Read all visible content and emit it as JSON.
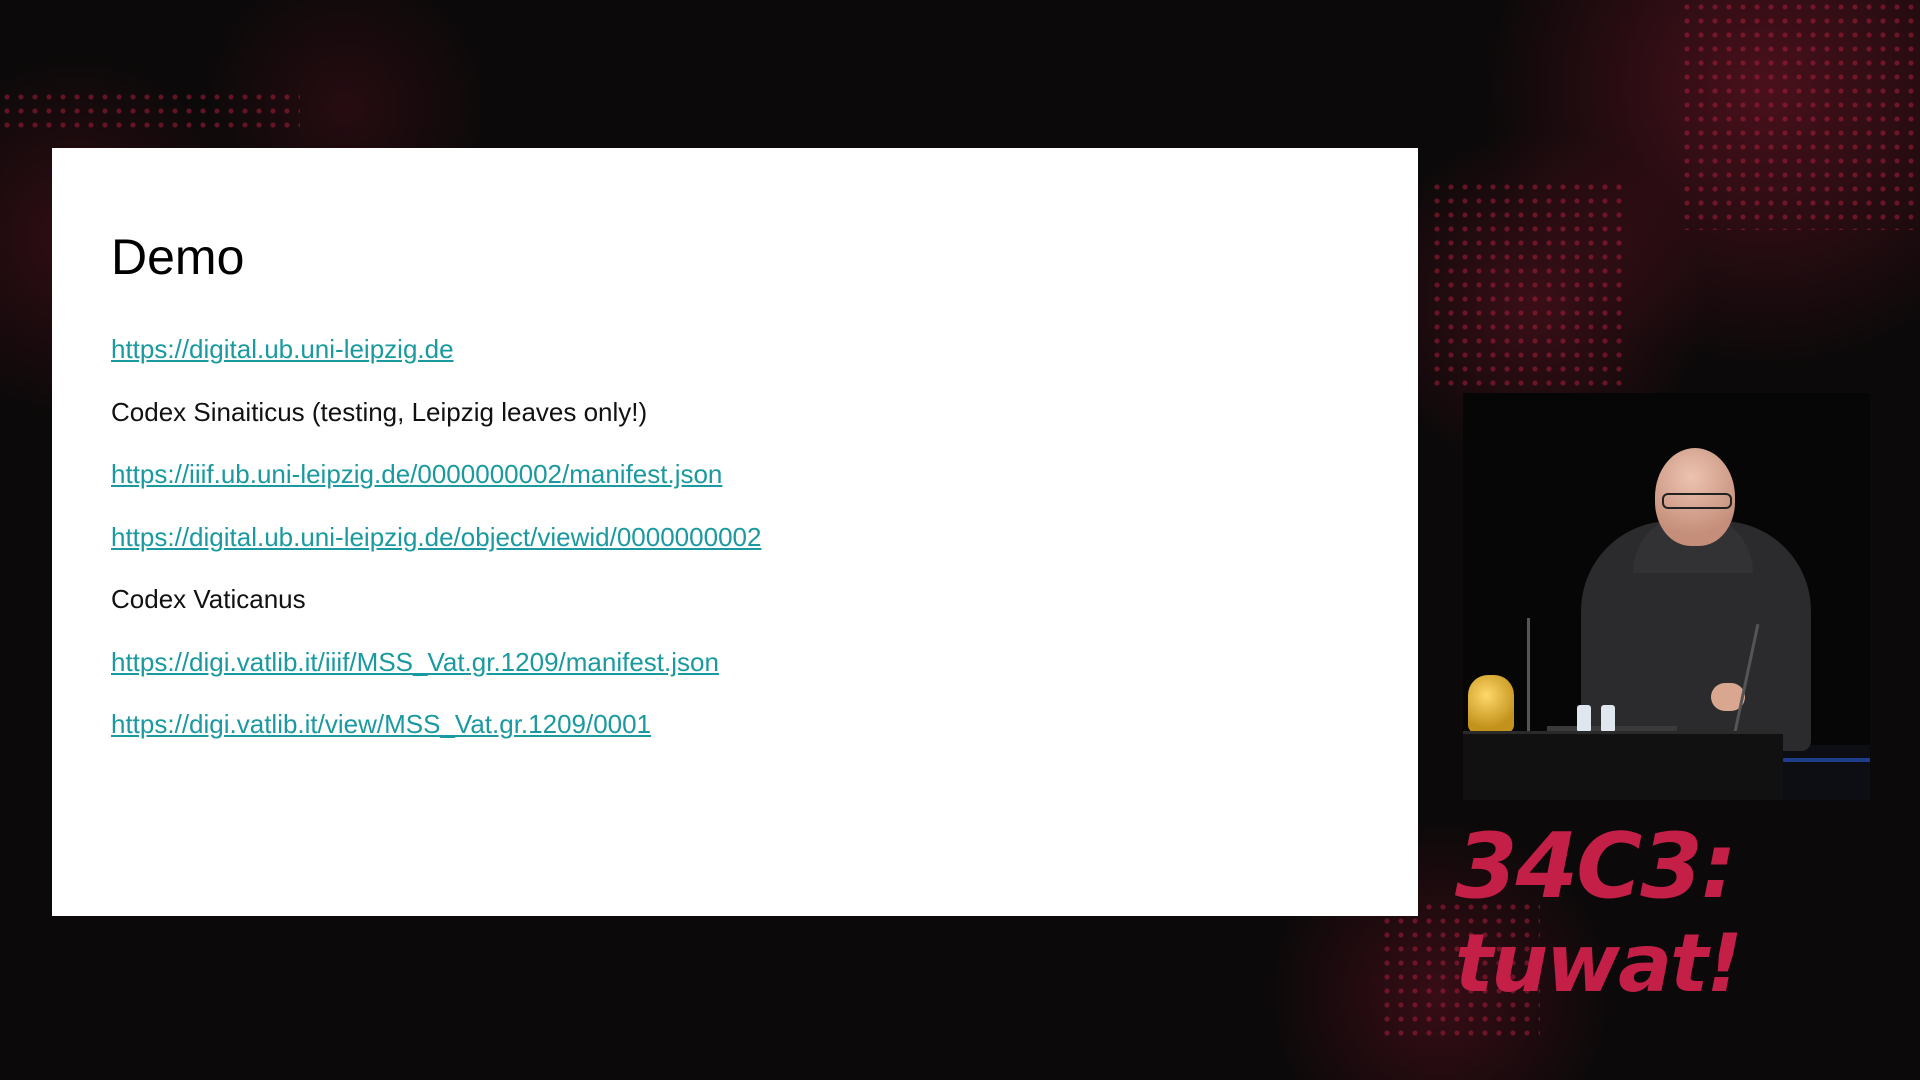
{
  "slide": {
    "title": "Demo",
    "lines": [
      {
        "text": "https://digital.ub.uni-leipzig.de",
        "is_link": true
      },
      {
        "text": "Codex Sinaiticus (testing, Leipzig leaves only!)",
        "is_link": false
      },
      {
        "text": "https://iiif.ub.uni-leipzig.de/0000000002/manifest.json",
        "is_link": true
      },
      {
        "text": "https://digital.ub.uni-leipzig.de/object/viewid/0000000002",
        "is_link": true
      },
      {
        "text": "Codex Vaticanus",
        "is_link": false
      },
      {
        "text": "https://digi.vatlib.it/iiif/MSS_Vat.gr.1209/manifest.json",
        "is_link": true
      },
      {
        "text": "https://digi.vatlib.it/view/MSS_Vat.gr.1209/0001",
        "is_link": true
      }
    ],
    "link_color": "#1a9aa0"
  },
  "event_logo": {
    "line1": "34C3:",
    "line2": "tuwat!",
    "color": "#c41f47"
  }
}
